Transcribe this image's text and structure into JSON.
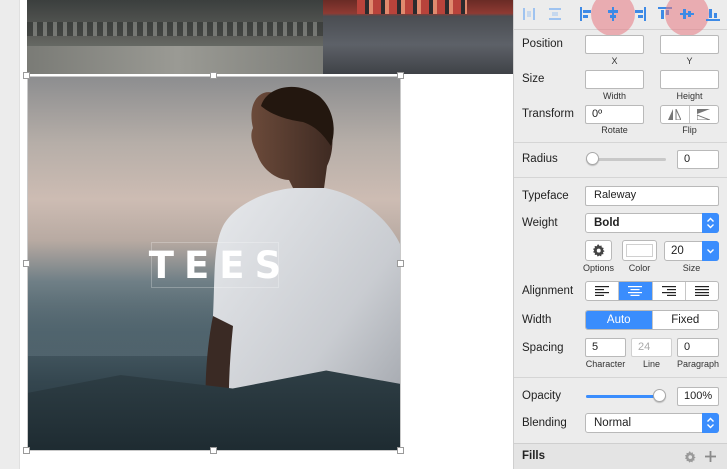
{
  "canvas": {
    "text_layer": "TEES"
  },
  "inspector": {
    "position": {
      "label": "Position",
      "x_value": "",
      "y_value": "",
      "x_caption": "X",
      "y_caption": "Y"
    },
    "size": {
      "label": "Size",
      "width_value": "",
      "height_value": "",
      "width_caption": "Width",
      "height_caption": "Height"
    },
    "transform": {
      "label": "Transform",
      "rotate_value": "0º",
      "rotate_caption": "Rotate",
      "flip_caption": "Flip"
    },
    "radius": {
      "label": "Radius",
      "value": "0",
      "slider_fraction": 0
    },
    "typeface": {
      "label": "Typeface",
      "value": "Raleway"
    },
    "weight": {
      "label": "Weight",
      "value": "Bold"
    },
    "options": {
      "options_caption": "Options",
      "color_caption": "Color",
      "size_caption": "Size",
      "size_value": "20"
    },
    "alignment": {
      "label": "Alignment",
      "active_index": 1
    },
    "width": {
      "label": "Width",
      "auto_label": "Auto",
      "fixed_label": "Fixed",
      "active": "auto"
    },
    "spacing": {
      "label": "Spacing",
      "character_value": "5",
      "line_value": "24",
      "paragraph_value": "0",
      "character_caption": "Character",
      "line_caption": "Line",
      "paragraph_caption": "Paragraph"
    },
    "opacity": {
      "label": "Opacity",
      "value": "100%",
      "slider_fraction": 1
    },
    "blending": {
      "label": "Blending",
      "value": "Normal"
    },
    "fills": {
      "label": "Fills"
    }
  },
  "colors": {
    "accent": "#3a8dfd",
    "pressed_highlight": "#e87882"
  },
  "icons": {
    "align_buttons": [
      "align-left-edge-icon",
      "align-horizontal-center-icon",
      "align-right-edge-icon",
      "align-center-horizontally-icon",
      "align-top-edge-icon",
      "align-middle-vertically-icon",
      "align-bottom-edge-icon"
    ],
    "flip": [
      "flip-horizontal-icon",
      "flip-vertical-icon"
    ],
    "options": "gear-icon",
    "fills": [
      "gear-icon",
      "plus-icon"
    ]
  }
}
